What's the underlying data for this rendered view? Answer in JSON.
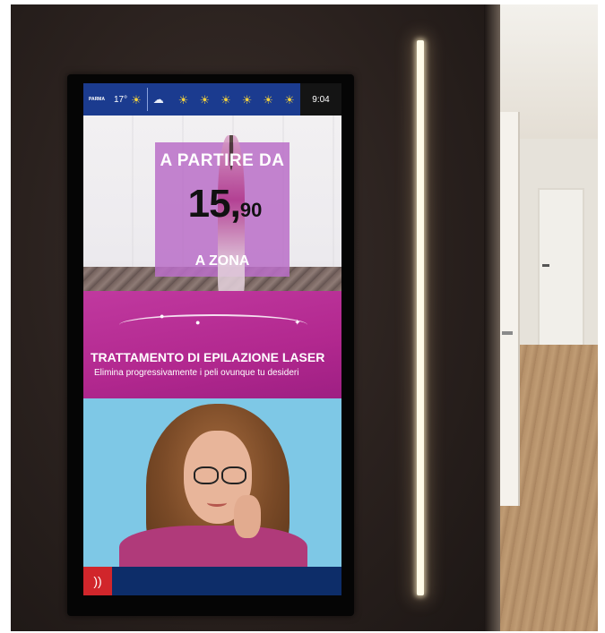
{
  "scene": {
    "description": ""
  },
  "topbar": {
    "city": "PARMA",
    "temperature": "17°",
    "current_icon": "sun-icon",
    "forecast_icons": [
      "cloud-icon",
      "sun-icon",
      "sun-icon",
      "sun-icon",
      "sun-icon",
      "sun-icon",
      "sun-icon"
    ],
    "time": "9:04"
  },
  "promo": {
    "headline": "A PARTIRE DA",
    "price_int": "15,",
    "price_dec": "90",
    "zone": "A ZONA",
    "treatment_title": "TRATTAMENTO DI EPILAZIONE LASER",
    "treatment_subtitle": "Elimina progressivamente i peli ovunque tu desideri"
  },
  "footer": {
    "feed_icon": "rss-icon"
  },
  "colors": {
    "topbar": "#1b3b8f",
    "magenta": "#b2288f",
    "portrait_bg": "#7ec8e6",
    "rss": "#d1262b"
  }
}
